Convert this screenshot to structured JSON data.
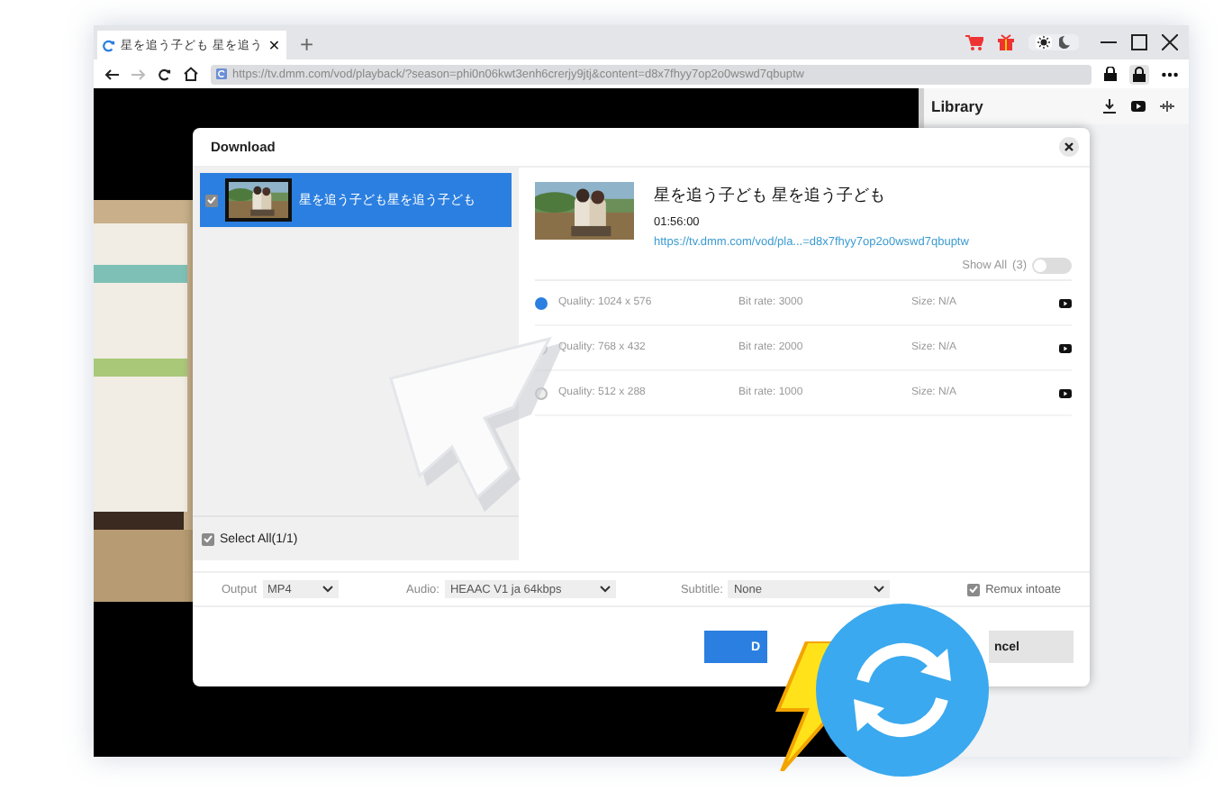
{
  "browser": {
    "tab": {
      "title": "星を追う子ども 星を追う",
      "close": "✕",
      "selected": true
    },
    "new_tab": "+",
    "theme": {
      "dark": false
    },
    "address": "https://tv.dmm.com/vod/playback/?season=phi0n06kwt3enh6crerjy9jtj&content=d8x7fhyy7op2o0wswd7qbuptw"
  },
  "library": {
    "title": "Library"
  },
  "dialog": {
    "title": "Download",
    "items": [
      {
        "title": "星を追う子ども星を追う子ども",
        "checked": true,
        "selected": true
      }
    ],
    "select_all": {
      "label": "Select All(1/1)",
      "checked": true
    },
    "detail": {
      "title": "星を追う子ども 星を追う子ども",
      "duration": "01:56:00",
      "url": "https://tv.dmm.com/vod/pla...=d8x7fhyy7op2o0wswd7qbuptw",
      "show_all": {
        "label": "Show All",
        "count": "(3)",
        "on": false
      }
    },
    "qualities": [
      {
        "quality": "Quality: 1024 x 576",
        "bitrate": "Bit rate: 3000",
        "size": "Size: N/A",
        "selected": true
      },
      {
        "quality": "Quality: 768 x 432",
        "bitrate": "Bit rate: 2000",
        "size": "Size: N/A",
        "selected": false
      },
      {
        "quality": "Quality: 512 x 288",
        "bitrate": "Bit rate: 1000",
        "size": "Size: N/A",
        "selected": false
      }
    ],
    "options": {
      "output": {
        "label": "Output",
        "value": "MP4"
      },
      "audio": {
        "label": "Audio:",
        "value": "HEAAC V1 ja 64kbps"
      },
      "subtitle": {
        "label": "Subtitle:",
        "value": "None"
      },
      "remux": {
        "label": "Remux intoate",
        "checked": true
      }
    },
    "buttons": [
      {
        "label": "D",
        "kind": "primary"
      },
      {
        "label": "ncel",
        "kind": "secondary"
      }
    ]
  }
}
